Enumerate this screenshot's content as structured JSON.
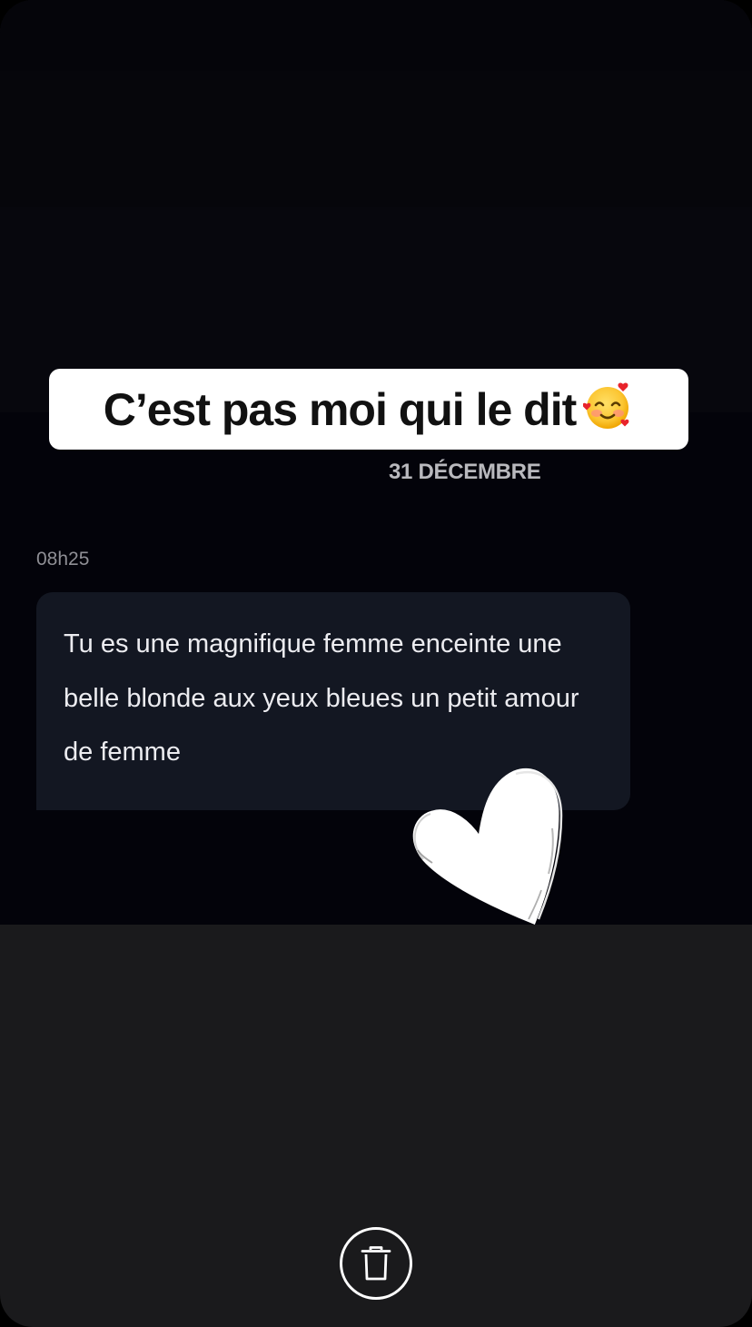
{
  "caption": {
    "text": "C’est pas moi qui le dit",
    "emoji": "smiling-face-with-hearts-icon"
  },
  "conversation": {
    "date": "31 DÉCEMBRE",
    "time": "08h25",
    "message": "Tu es une magnifique femme enceinte une belle blonde aux yeux bleues un petit amour de femme"
  },
  "stickers": {
    "heart": "heart-icon"
  },
  "toolbar": {
    "delete_icon": "trash-icon"
  },
  "colors": {
    "background": "#1a1a1c",
    "screenshot_background": "#03030a",
    "bubble": "#131722",
    "caption_bg": "#ffffff",
    "caption_text": "#111111"
  }
}
